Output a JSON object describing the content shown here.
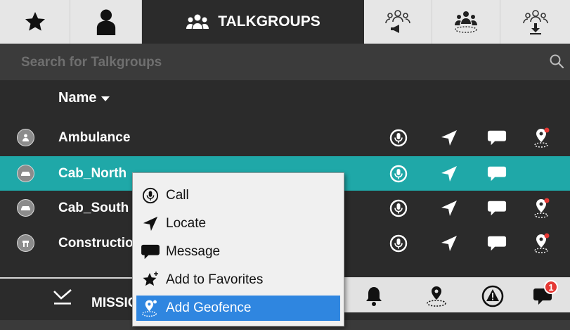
{
  "tabs": {
    "talkgroups_label": "TALKGROUPS"
  },
  "search": {
    "placeholder": "Search for Talkgroups"
  },
  "list": {
    "column_name": "Name",
    "rows": [
      {
        "name": "Ambulance",
        "selected": false,
        "geofence": true
      },
      {
        "name": "Cab_North",
        "selected": true,
        "geofence": false
      },
      {
        "name": "Cab_South",
        "selected": false,
        "geofence": true
      },
      {
        "name": "Construction",
        "selected": false,
        "geofence": true
      }
    ]
  },
  "context_menu": {
    "items": [
      {
        "label": "Call",
        "icon": "microphone-icon"
      },
      {
        "label": "Locate",
        "icon": "locate-arrow-icon"
      },
      {
        "label": "Message",
        "icon": "message-icon"
      },
      {
        "label": "Add to Favorites",
        "icon": "star-plus-icon"
      },
      {
        "label": "Add Geofence",
        "icon": "geofence-icon",
        "highlighted": true
      }
    ]
  },
  "bottom": {
    "missions_label": "MISSIONS",
    "notification_count": "1"
  },
  "colors": {
    "selected_row": "#1fa8a8",
    "menu_highlight": "#2f86e0",
    "badge": "#e53935"
  }
}
